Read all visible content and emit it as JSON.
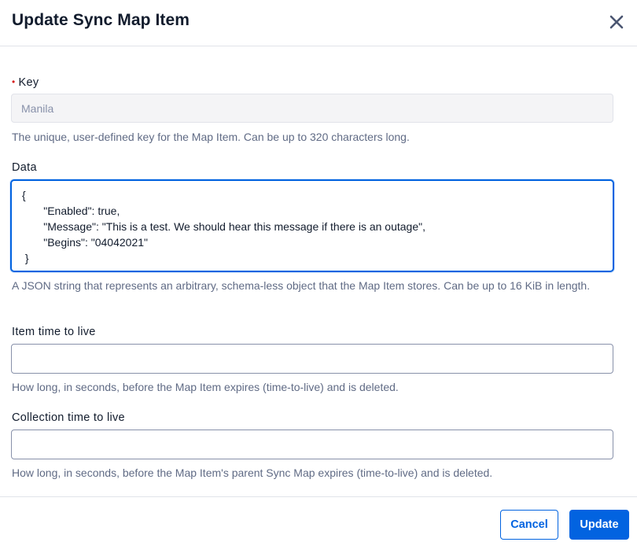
{
  "modal": {
    "title": "Update Sync Map Item",
    "close_icon": "close-icon"
  },
  "key": {
    "label": "Key",
    "required": true,
    "value": "Manila",
    "help": "The unique, user-defined key for the Map Item. Can be up to 320 characters long."
  },
  "data": {
    "label": "Data",
    "value": "{\n       \"Enabled\": true,\n       \"Message\": \"This is a test. We should hear this message if there is an outage\",\n       \"Begins\": \"04042021\"\n }",
    "help": "A JSON string that represents an arbitrary, schema-less object that the Map Item stores. Can be up to 16 KiB in length."
  },
  "item_ttl": {
    "label": "Item time to live",
    "value": "",
    "help": "How long, in seconds, before the Map Item expires (time-to-live) and is deleted."
  },
  "collection_ttl": {
    "label": "Collection time to live",
    "value": "",
    "help": "How long, in seconds, before the Map Item's parent Sync Map expires (time-to-live) and is deleted."
  },
  "footer": {
    "cancel_label": "Cancel",
    "update_label": "Update"
  },
  "colors": {
    "primary": "#0263e0",
    "required": "#d61f1f",
    "help_text": "#606b85"
  }
}
